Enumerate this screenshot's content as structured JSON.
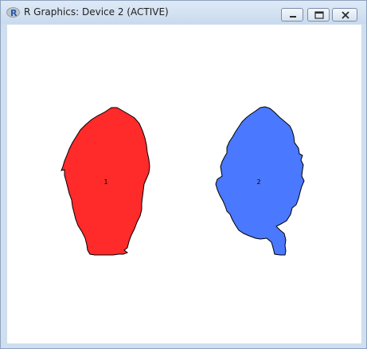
{
  "window": {
    "title": "R Graphics: Device 2 (ACTIVE)",
    "app_icon": "r-logo-icon",
    "controls": [
      "minimize-icon",
      "maximize-icon",
      "close-icon"
    ]
  },
  "plot": {
    "background": "#ffffff",
    "regions": [
      {
        "label": "1",
        "fill": "#ff2a2a",
        "stroke": "#000000"
      },
      {
        "label": "2",
        "fill": "#4a78ff",
        "stroke": "#000000"
      }
    ]
  }
}
